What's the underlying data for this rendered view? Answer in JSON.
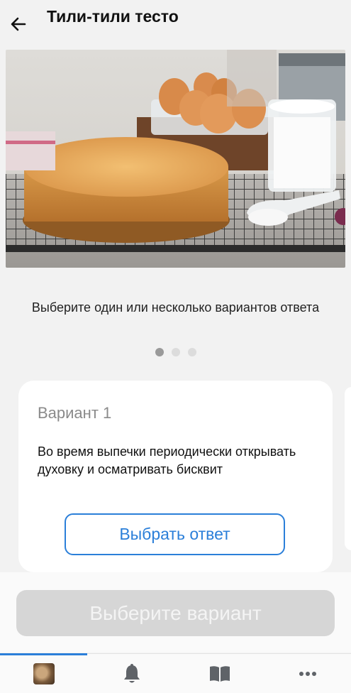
{
  "header": {
    "title": "Тили-тили тесто",
    "back_icon": "arrow-left-icon"
  },
  "hero": {
    "image": "sponge-cake-photo"
  },
  "question": {
    "text": "Выберите один или несколько вариантов ответа"
  },
  "pager": {
    "total": 3,
    "active": 1
  },
  "card": {
    "title": "Вариант 1",
    "text": "Во время выпечки периодически открывать духовку и осматривать бисквит",
    "choose_label": "Выбрать ответ"
  },
  "submit": {
    "label": "Выберите вариант"
  },
  "colors": {
    "accent": "#2b7fd9",
    "disabled": "#d6d6d6"
  },
  "tabbar": {
    "tabs": [
      {
        "icon": "avatar-icon",
        "active": true
      },
      {
        "icon": "bell-icon",
        "active": false
      },
      {
        "icon": "book-icon",
        "active": false
      },
      {
        "icon": "more-icon",
        "active": false
      }
    ]
  }
}
